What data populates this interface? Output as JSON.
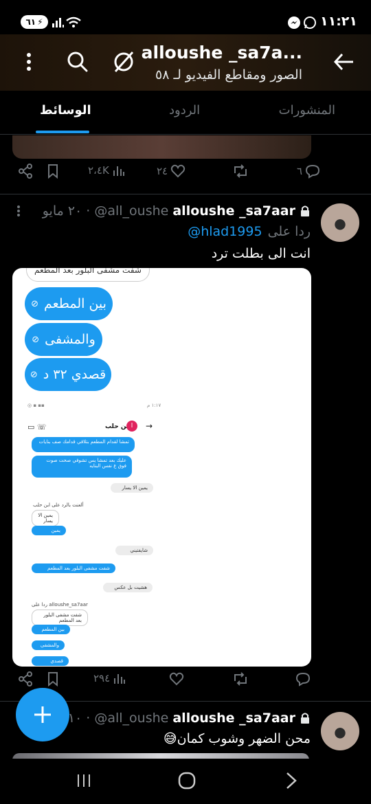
{
  "status": {
    "time": "١١:٢١",
    "battery": "٦١"
  },
  "header": {
    "title": "alloushe _sa7a...",
    "subtitle": "الصور ومقاطع الفيديو لـ ٥٨"
  },
  "tabs": [
    {
      "label": "المنشورات"
    },
    {
      "label": "الردود"
    },
    {
      "label": "الوسائط"
    }
  ],
  "prev_post": {
    "replies": "٦",
    "likes": "٢٤",
    "views": "٢،٤K"
  },
  "tweet1": {
    "name": "alloushe _sa7aar",
    "handle": "@all_oushe",
    "time": "· ٢٠ مايو",
    "reply_prefix": "ردا على",
    "reply_to": "@hlad1995",
    "text": "انت الى بطلت ترد",
    "views": "٢٩٤",
    "media": {
      "top_text": "شفت مشفى البلور بعد المطعم",
      "bubbles": [
        "بين المطعم",
        "والمشفى",
        "قصدي  ٣٢ د"
      ],
      "chat_name": "ابن حلب",
      "chat_avatar": "ا",
      "phone_time": "١:١٧ م",
      "msgs": [
        "تمشا لقدام المطعم بتلاقي قدامك صف بنايات",
        "عليك بعد تمشا يس تشوفي صحت صوت فوق ع نفس البنايه",
        "يمين الا يسار",
        "ألعنت بالرد على ابن حلب",
        "يمين الا يسار",
        "يمين",
        "شايفتيني",
        "شفت مشفى البلور بعد المطعم",
        "هشيت بل عكس",
        "alloushe_sa7aar ردا على",
        "شفت مشفى البلور بعد المطعم",
        "بين المطعم",
        "والمشفى",
        "قصدي"
      ]
    }
  },
  "tweet2": {
    "name": "alloushe _sa7aar",
    "handle": "@all_oushe",
    "time": "· ١٠ ما",
    "text": "محن الضهر وشوب كمان😅"
  },
  "icons": [
    "back-arrow-icon",
    "shield-off-icon",
    "search-icon",
    "more-vertical-icon",
    "lock-icon",
    "reply-icon",
    "retweet-icon",
    "heart-icon",
    "views-icon",
    "bookmark-icon",
    "share-icon",
    "plus-icon"
  ],
  "colors": {
    "accent": "#1d9bf0",
    "background": "#000000",
    "muted": "#71767b"
  }
}
